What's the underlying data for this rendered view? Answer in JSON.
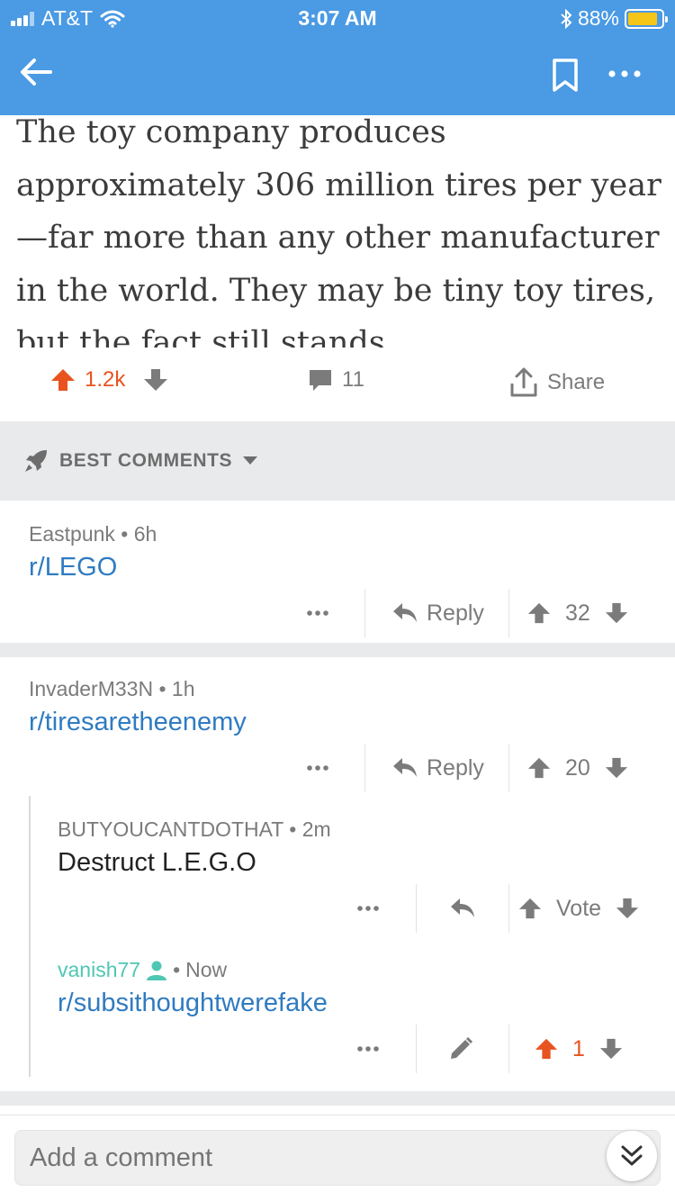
{
  "status_bar": {
    "carrier": "AT&T",
    "time": "3:07 AM",
    "battery": "88%",
    "battery_level": 0.88
  },
  "nav": {
    "back_icon": "arrow-left-icon",
    "bookmark_icon": "bookmark-icon",
    "more_icon": "more-dots-icon"
  },
  "post": {
    "text": "The toy company produces approximately 306 million tires per year—far more than any other manufacturer in the world. They may be tiny toy tires, but the fact still stands.",
    "score": "1.2k",
    "comment_count": "11",
    "share_label": "Share"
  },
  "sort": {
    "label": "BEST COMMENTS"
  },
  "comments": [
    {
      "author": "Eastpunk",
      "age": "6h",
      "body": "r/LEGO",
      "reply_label": "Reply",
      "score": "32"
    },
    {
      "author": "InvaderM33N",
      "age": "1h",
      "body": "r/tiresaretheenemy",
      "reply_label": "Reply",
      "score": "20"
    },
    {
      "author": "BUTYOUCANTDOTHAT",
      "age": "2m",
      "body": "Destruct L.E.G.O",
      "vote_label": "Vote"
    },
    {
      "author": "vanish77",
      "age": "Now",
      "body": "r/subsithoughtwerefake",
      "score": "1"
    }
  ],
  "composer": {
    "placeholder": "Add a comment"
  },
  "colors": {
    "header": "#4a9ae4",
    "upvote": "#e8531f",
    "link": "#2f7bc1",
    "own_user": "#4fc7b4"
  }
}
